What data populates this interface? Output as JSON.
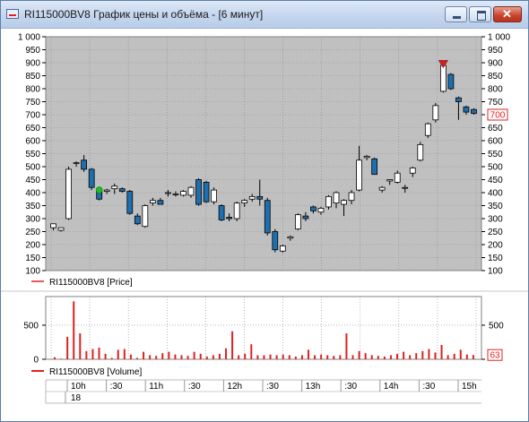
{
  "window": {
    "title": "RI115000BV8 График цены и объёма - [6 минут]",
    "close_glyph": "✕"
  },
  "colors": {
    "up_candle": "#ffffff",
    "down_candle": "#1f6fae",
    "volume_bar": "#e02020",
    "plot_bg": "#c0c0c0",
    "grid": "#8a8a8a",
    "last_price_marker": "#e02020",
    "max_marker": "#d42020",
    "min_marker": "#22bb22"
  },
  "icons": [
    "app-chart-icon",
    "minimize-icon",
    "maximize-icon",
    "close-icon",
    "max-price-marker-icon",
    "min-price-marker-icon"
  ],
  "price_panel": {
    "legend": "RI115000BV8 [Price]",
    "last_value_label": "700",
    "y_ticks": [
      "1 000",
      "950",
      "900",
      "850",
      "800",
      "750",
      "700",
      "650",
      "600",
      "550",
      "500",
      "450",
      "400",
      "350",
      "300",
      "250",
      "200",
      "150",
      "100"
    ]
  },
  "volume_panel": {
    "legend": "RI115000BV8 [Volume]",
    "last_value_label": "63",
    "y_ticks": [
      "500",
      "0"
    ]
  },
  "time_axis": {
    "labels": [
      "10h",
      ":30",
      "11h",
      ":30",
      "12h",
      ":30",
      "13h",
      ":30",
      "14h",
      ":30",
      "15h"
    ],
    "day_label": "18"
  },
  "chart_data": [
    {
      "type": "candlestick",
      "title": "",
      "legend": [
        "RI115000BV8 [Price]"
      ],
      "ylim": [
        100,
        1000
      ],
      "ytick_step": 50,
      "grid": true,
      "x_unit": "6-minute bars",
      "candles": [
        {
          "o": 265,
          "h": 280,
          "l": 255,
          "c": 280
        },
        {
          "o": 255,
          "h": 265,
          "l": 250,
          "c": 265
        },
        {
          "o": 300,
          "h": 500,
          "l": 295,
          "c": 490
        },
        {
          "o": 515,
          "h": 520,
          "l": 500,
          "c": 515
        },
        {
          "o": 525,
          "h": 545,
          "l": 480,
          "c": 490
        },
        {
          "o": 490,
          "h": 495,
          "l": 410,
          "c": 420
        },
        {
          "o": 410,
          "h": 420,
          "l": 370,
          "c": 375
        },
        {
          "o": 405,
          "h": 415,
          "l": 395,
          "c": 410
        },
        {
          "o": 415,
          "h": 435,
          "l": 395,
          "c": 425
        },
        {
          "o": 415,
          "h": 420,
          "l": 400,
          "c": 405
        },
        {
          "o": 405,
          "h": 410,
          "l": 315,
          "c": 320
        },
        {
          "o": 310,
          "h": 320,
          "l": 275,
          "c": 280
        },
        {
          "o": 270,
          "h": 355,
          "l": 265,
          "c": 350
        },
        {
          "o": 360,
          "h": 380,
          "l": 350,
          "c": 370
        },
        {
          "o": 370,
          "h": 380,
          "l": 355,
          "c": 355
        },
        {
          "o": 400,
          "h": 410,
          "l": 385,
          "c": 400
        },
        {
          "o": 395,
          "h": 405,
          "l": 385,
          "c": 395
        },
        {
          "o": 390,
          "h": 410,
          "l": 385,
          "c": 405
        },
        {
          "o": 390,
          "h": 425,
          "l": 380,
          "c": 420
        },
        {
          "o": 450,
          "h": 455,
          "l": 350,
          "c": 355
        },
        {
          "o": 440,
          "h": 445,
          "l": 360,
          "c": 365
        },
        {
          "o": 365,
          "h": 420,
          "l": 355,
          "c": 410
        },
        {
          "o": 350,
          "h": 355,
          "l": 290,
          "c": 295
        },
        {
          "o": 305,
          "h": 320,
          "l": 290,
          "c": 300
        },
        {
          "o": 300,
          "h": 365,
          "l": 290,
          "c": 360
        },
        {
          "o": 360,
          "h": 375,
          "l": 345,
          "c": 370
        },
        {
          "o": 375,
          "h": 395,
          "l": 365,
          "c": 385
        },
        {
          "o": 385,
          "h": 450,
          "l": 350,
          "c": 375
        },
        {
          "o": 370,
          "h": 380,
          "l": 235,
          "c": 245
        },
        {
          "o": 250,
          "h": 260,
          "l": 170,
          "c": 180
        },
        {
          "o": 175,
          "h": 200,
          "l": 170,
          "c": 195
        },
        {
          "o": 225,
          "h": 235,
          "l": 215,
          "c": 230
        },
        {
          "o": 260,
          "h": 320,
          "l": 255,
          "c": 315
        },
        {
          "o": 310,
          "h": 325,
          "l": 290,
          "c": 300
        },
        {
          "o": 345,
          "h": 350,
          "l": 320,
          "c": 330
        },
        {
          "o": 325,
          "h": 345,
          "l": 315,
          "c": 340
        },
        {
          "o": 345,
          "h": 390,
          "l": 335,
          "c": 385
        },
        {
          "o": 360,
          "h": 405,
          "l": 340,
          "c": 400
        },
        {
          "o": 355,
          "h": 375,
          "l": 310,
          "c": 370
        },
        {
          "o": 370,
          "h": 410,
          "l": 355,
          "c": 400
        },
        {
          "o": 410,
          "h": 580,
          "l": 405,
          "c": 525
        },
        {
          "o": 535,
          "h": 545,
          "l": 525,
          "c": 540
        },
        {
          "o": 530,
          "h": 535,
          "l": 470,
          "c": 470
        },
        {
          "o": 410,
          "h": 425,
          "l": 400,
          "c": 420
        },
        {
          "o": 445,
          "h": 450,
          "l": 430,
          "c": 450
        },
        {
          "o": 440,
          "h": 485,
          "l": 435,
          "c": 475
        },
        {
          "o": 420,
          "h": 430,
          "l": 400,
          "c": 420
        },
        {
          "o": 475,
          "h": 500,
          "l": 460,
          "c": 495
        },
        {
          "o": 525,
          "h": 595,
          "l": 520,
          "c": 585
        },
        {
          "o": 620,
          "h": 670,
          "l": 610,
          "c": 665
        },
        {
          "o": 680,
          "h": 745,
          "l": 670,
          "c": 735
        },
        {
          "o": 790,
          "h": 905,
          "l": 785,
          "c": 890
        },
        {
          "o": 855,
          "h": 860,
          "l": 795,
          "c": 800
        },
        {
          "o": 765,
          "h": 770,
          "l": 680,
          "c": 750
        },
        {
          "o": 730,
          "h": 735,
          "l": 700,
          "c": 710
        },
        {
          "o": 720,
          "h": 725,
          "l": 700,
          "c": 705
        }
      ],
      "max_marker_value": 895,
      "min_marker_value": 410
    },
    {
      "type": "bar",
      "title": "",
      "legend": [
        "RI115000BV8 [Volume]"
      ],
      "ylim": [
        0,
        920
      ],
      "yticks": [
        0,
        500
      ],
      "grid": true,
      "values": [
        30,
        10,
        330,
        850,
        380,
        120,
        150,
        170,
        80,
        20,
        140,
        150,
        70,
        20,
        110,
        60,
        50,
        90,
        110,
        70,
        60,
        50,
        110,
        80,
        40,
        60,
        80,
        160,
        410,
        60,
        80,
        220,
        60,
        60,
        70,
        60,
        70,
        60,
        40,
        60,
        140,
        60,
        70,
        60,
        50,
        60,
        380,
        60,
        120,
        90,
        60,
        50,
        40,
        60,
        80,
        110,
        60,
        90,
        120,
        150,
        100,
        210,
        60,
        80,
        140,
        70,
        63
      ]
    }
  ]
}
